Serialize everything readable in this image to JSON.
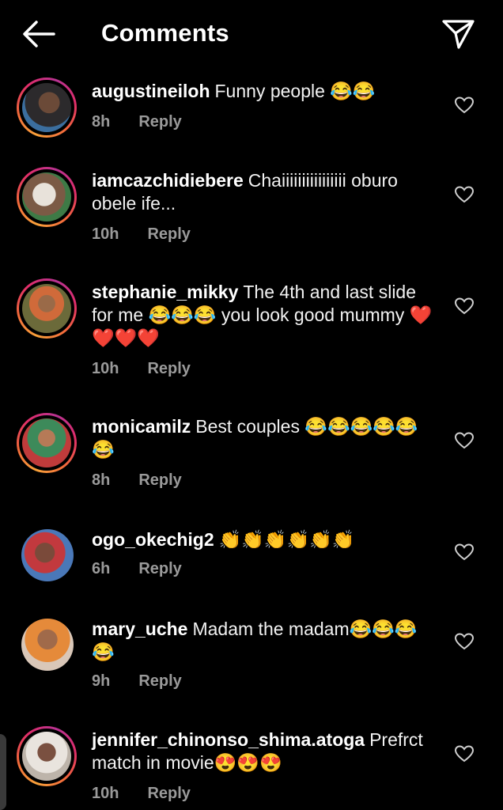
{
  "header": {
    "title": "Comments"
  },
  "comments": [
    {
      "username": "augustineiloh",
      "text": "Funny people 😂😂",
      "time": "8h",
      "reply": "Reply"
    },
    {
      "username": "iamcazchidiebere",
      "text": "Chaiiiiiiiiiiiiiiii oburo obele ife...",
      "time": "10h",
      "reply": "Reply"
    },
    {
      "username": "stephanie_mikky",
      "text": "The 4th and last slide for me 😂😂😂 you look good mummy ❤️❤️❤️❤️",
      "time": "10h",
      "reply": "Reply"
    },
    {
      "username": "monicamilz",
      "text": "Best couples 😂😂😂😂😂😂",
      "time": "8h",
      "reply": "Reply"
    },
    {
      "username": "ogo_okechig2",
      "text": "👏👏👏👏👏👏",
      "time": "6h",
      "reply": "Reply"
    },
    {
      "username": "mary_uche",
      "text": "Madam the madam😂😂😂😂",
      "time": "9h",
      "reply": "Reply"
    },
    {
      "username": "jennifer_chinonso_shima.atoga",
      "text": "Prefrct match in movie😍😍😍",
      "time": "10h",
      "reply": "Reply"
    }
  ],
  "colors": {
    "background": "#000000",
    "meta_text": "#9a9a9a",
    "story_ring": "#e02d6a"
  }
}
